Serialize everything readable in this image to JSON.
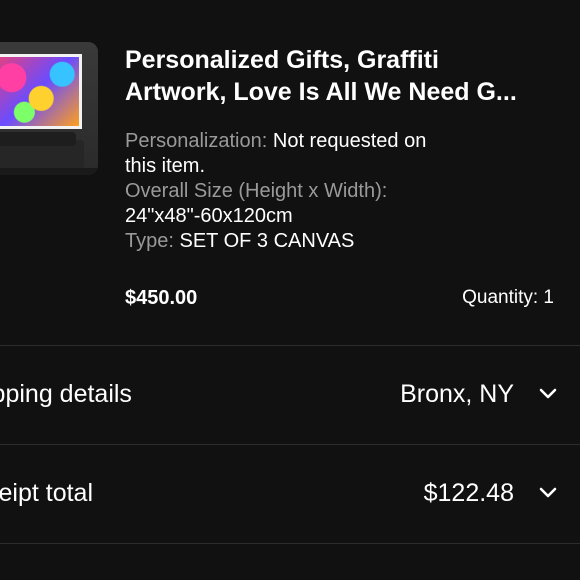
{
  "item": {
    "image_icon": "product-thumbnail",
    "title_line1": "Personalized Gifts, Graffiti",
    "title_line2": "Artwork, Love Is All We Need G...",
    "personalization_label": "Personalization:",
    "personalization_value_line1": "Not requested on",
    "personalization_value_line2": "this item.",
    "size_label": "Overall Size (Height x Width):",
    "size_value": "24\"x48\"-60x120cm",
    "type_label": "Type:",
    "type_value": "SET OF 3 CANVAS",
    "price": "$450.00",
    "quantity": "Quantity: 1"
  },
  "shipping": {
    "label": "ipping details",
    "value": "Bronx, NY",
    "icon": "chevron-down-icon"
  },
  "receipt": {
    "label": "ceipt total",
    "value": "$122.48",
    "icon": "chevron-down-icon"
  },
  "colors": {
    "background": "#111111",
    "text": "#ffffff",
    "muted": "#9a9a9a",
    "divider": "#2c2c2c"
  }
}
